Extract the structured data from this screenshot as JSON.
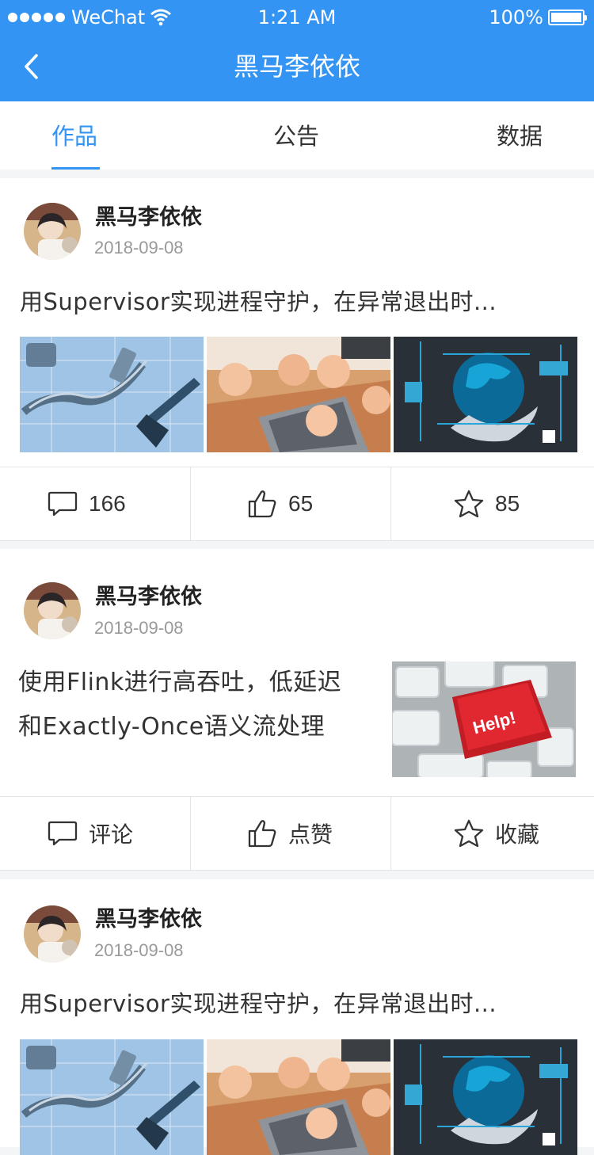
{
  "status": {
    "carrier": "WeChat",
    "time": "1:21 AM",
    "battery": "100%"
  },
  "nav": {
    "title": "黑马李依依"
  },
  "tabs": [
    {
      "label": "作品"
    },
    {
      "label": "公告"
    },
    {
      "label": "数据"
    }
  ],
  "posts": [
    {
      "author": "黑马李依依",
      "date": "2018-09-08",
      "title": "用Supervisor实现进程守护，在异常退出时...",
      "comments": "166",
      "likes": "65",
      "favorites": "85"
    },
    {
      "author": "黑马李依依",
      "date": "2018-09-08",
      "title_line1": "使用Flink进行高吞吐，低延迟",
      "title_line2": "和Exactly-Once语义流处理",
      "comment_label": "评论",
      "like_label": "点赞",
      "favorite_label": "收藏"
    },
    {
      "author": "黑马李依依",
      "date": "2018-09-08",
      "title": "用Supervisor实现进程守护，在异常退出时..."
    }
  ],
  "colors": {
    "brand": "#3394f3"
  }
}
